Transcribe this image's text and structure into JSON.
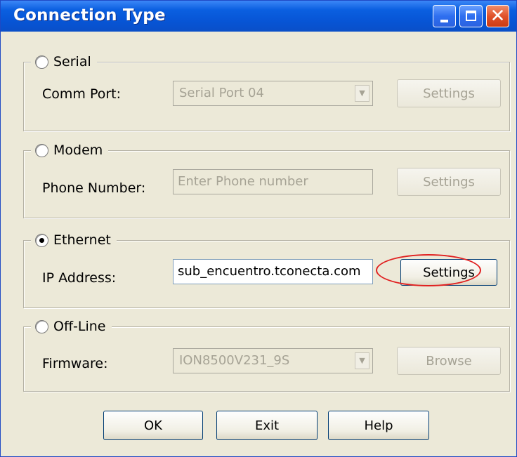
{
  "window": {
    "title": "Connection Type"
  },
  "serial": {
    "label": "Serial",
    "selected": false,
    "field_label": "Comm Port:",
    "port_value": "Serial Port 04",
    "settings_label": "Settings"
  },
  "modem": {
    "label": "Modem",
    "selected": false,
    "field_label": "Phone Number:",
    "phone_placeholder": "Enter Phone number",
    "settings_label": "Settings"
  },
  "ethernet": {
    "label": "Ethernet",
    "selected": true,
    "field_label": "IP Address:",
    "ip_value": "sub_encuentro.tconecta.com",
    "settings_label": "Settings"
  },
  "offline": {
    "label": "Off-Line",
    "selected": false,
    "field_label": "Firmware:",
    "firmware_value": "ION8500V231_9S",
    "browse_label": "Browse"
  },
  "buttons": {
    "ok": "OK",
    "exit": "Exit",
    "help": "Help"
  },
  "colors": {
    "titlebar": "#0754d4",
    "face": "#ece9d8",
    "highlight": "#e02020"
  }
}
